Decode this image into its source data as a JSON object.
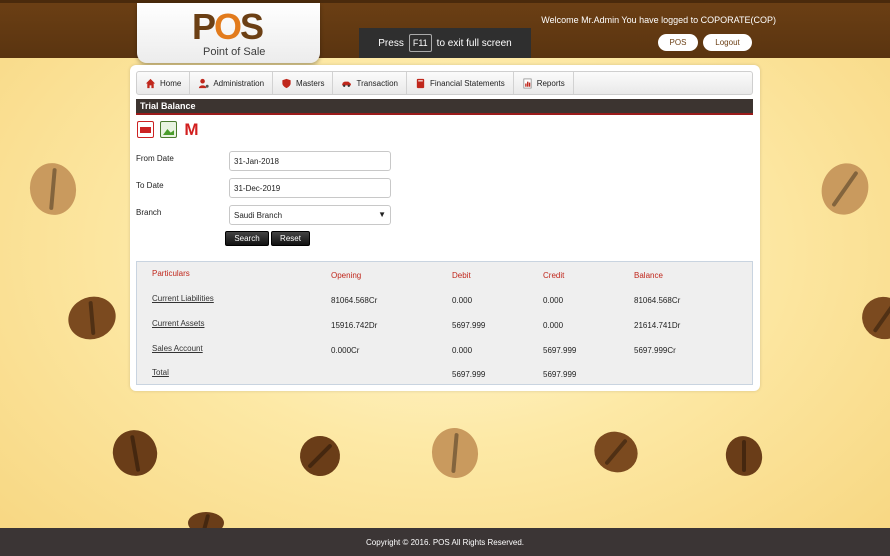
{
  "header": {
    "logo_text": "POS",
    "logo_subtitle": "Point of Sale",
    "fullscreen_prefix": "Press",
    "fullscreen_key": "F11",
    "fullscreen_suffix": "to exit full screen",
    "welcome": "Welcome Mr.Admin You have logged to COPORATE(COP)",
    "pos_button": "POS",
    "logout_button": "Logout"
  },
  "menu": {
    "items": [
      {
        "label": "Home",
        "icon": "home-icon"
      },
      {
        "label": "Administration",
        "icon": "user-icon"
      },
      {
        "label": "Masters",
        "icon": "shield-icon"
      },
      {
        "label": "Transaction",
        "icon": "car-icon"
      },
      {
        "label": "Financial Statements",
        "icon": "book-icon"
      },
      {
        "label": "Reports",
        "icon": "report-icon"
      }
    ]
  },
  "page": {
    "title": "Trial Balance",
    "export_icons": [
      "pdf-icon",
      "image-export-icon",
      "gmail-icon"
    ]
  },
  "form": {
    "from_date_label": "From Date",
    "from_date_value": "31-Jan-2018",
    "to_date_label": "To Date",
    "to_date_value": "31-Dec-2019",
    "branch_label": "Branch",
    "branch_value": "Saudi Branch",
    "search_button": "Search",
    "reset_button": "Reset"
  },
  "table": {
    "headers": [
      "Particulars",
      "Opening",
      "Debit",
      "Credit",
      "Balance"
    ],
    "rows": [
      {
        "particulars": "Current Liabilities",
        "opening": "81064.568Cr",
        "debit": "0.000",
        "credit": "0.000",
        "balance": "81064.568Cr"
      },
      {
        "particulars": "Current Assets",
        "opening": "15916.742Dr",
        "debit": "5697.999",
        "credit": "0.000",
        "balance": "21614.741Dr"
      },
      {
        "particulars": "Sales Account",
        "opening": "0.000Cr",
        "debit": "0.000",
        "credit": "5697.999",
        "balance": "5697.999Cr"
      },
      {
        "particulars": "Total",
        "opening": "",
        "debit": "5697.999",
        "credit": "5697.999",
        "balance": ""
      }
    ]
  },
  "footer": {
    "copyright": "Copyright © 2016. POS All Rights Reserved."
  },
  "colors": {
    "header_brown": "#5a3410",
    "logo_orange": "#e27b1c",
    "accent_red": "#c0271c",
    "footer_dark": "#3b3535"
  }
}
